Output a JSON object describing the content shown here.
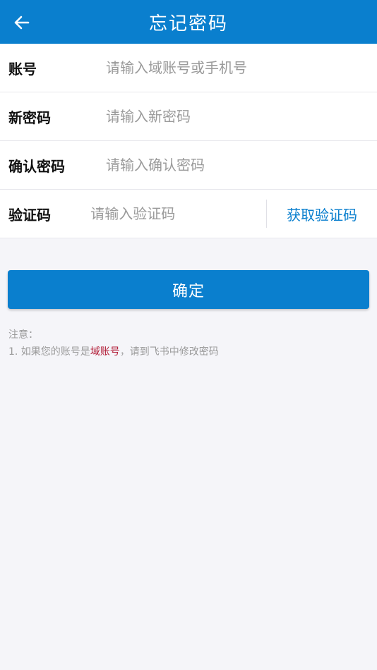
{
  "header": {
    "title": "忘记密码",
    "back_icon": "arrow-left-icon"
  },
  "form": {
    "account": {
      "label": "账号",
      "placeholder": "请输入域账号或手机号",
      "value": ""
    },
    "new_password": {
      "label": "新密码",
      "placeholder": "请输入新密码",
      "value": ""
    },
    "confirm_password": {
      "label": "确认密码",
      "placeholder": "请输入确认密码",
      "value": ""
    },
    "verification": {
      "label": "验证码",
      "placeholder": "请输入验证码",
      "value": "",
      "get_code_label": "获取验证码"
    }
  },
  "confirm_button": {
    "label": "确定"
  },
  "notes": {
    "heading": "注意：",
    "line1_prefix": "1. 如果您的账号是",
    "line1_highlight": "域账号",
    "line1_suffix": "，请到飞书中修改密码"
  },
  "colors": {
    "primary": "#0a7fce",
    "highlight": "#b3203a",
    "background": "#f5f5f9"
  }
}
